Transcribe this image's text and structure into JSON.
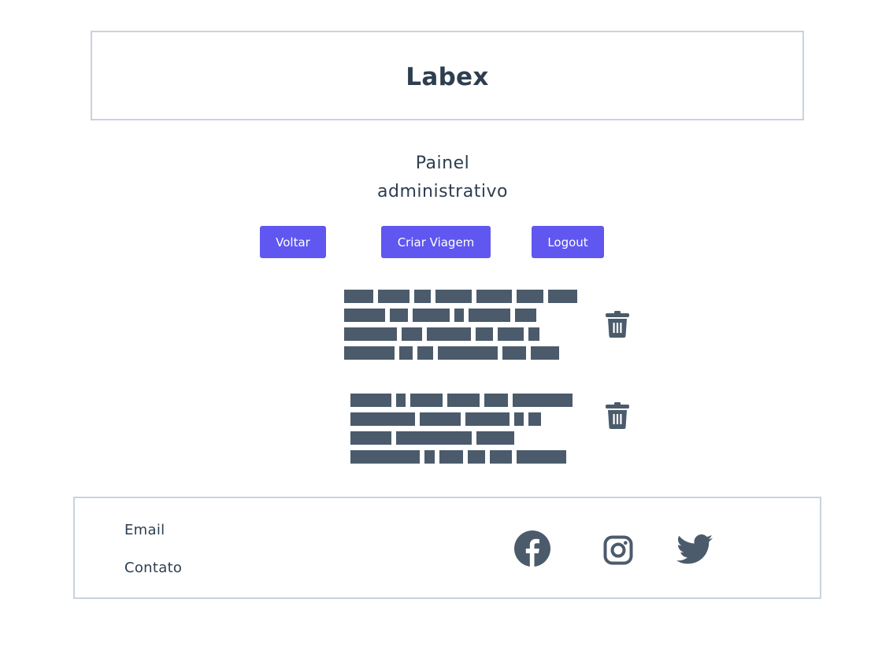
{
  "header": {
    "title": "Labex"
  },
  "page": {
    "heading": "Painel administrativo"
  },
  "actions": {
    "back_label": "Voltar",
    "create_trip_label": "Criar Viagem",
    "logout_label": "Logout"
  },
  "trips": [
    {
      "name": "redacted trip name",
      "delete_icon": "trash-icon"
    },
    {
      "name": "redacted trip name",
      "delete_icon": "trash-icon"
    }
  ],
  "footer": {
    "links": [
      "Email",
      "Contato"
    ],
    "social_icons": [
      "facebook-icon",
      "instagram-icon",
      "twitter-icon"
    ]
  },
  "colors": {
    "primary_button": "#5f57f0",
    "text": "#2d3e50",
    "border": "#c9d3dd",
    "icon": "#4b5b6b"
  }
}
